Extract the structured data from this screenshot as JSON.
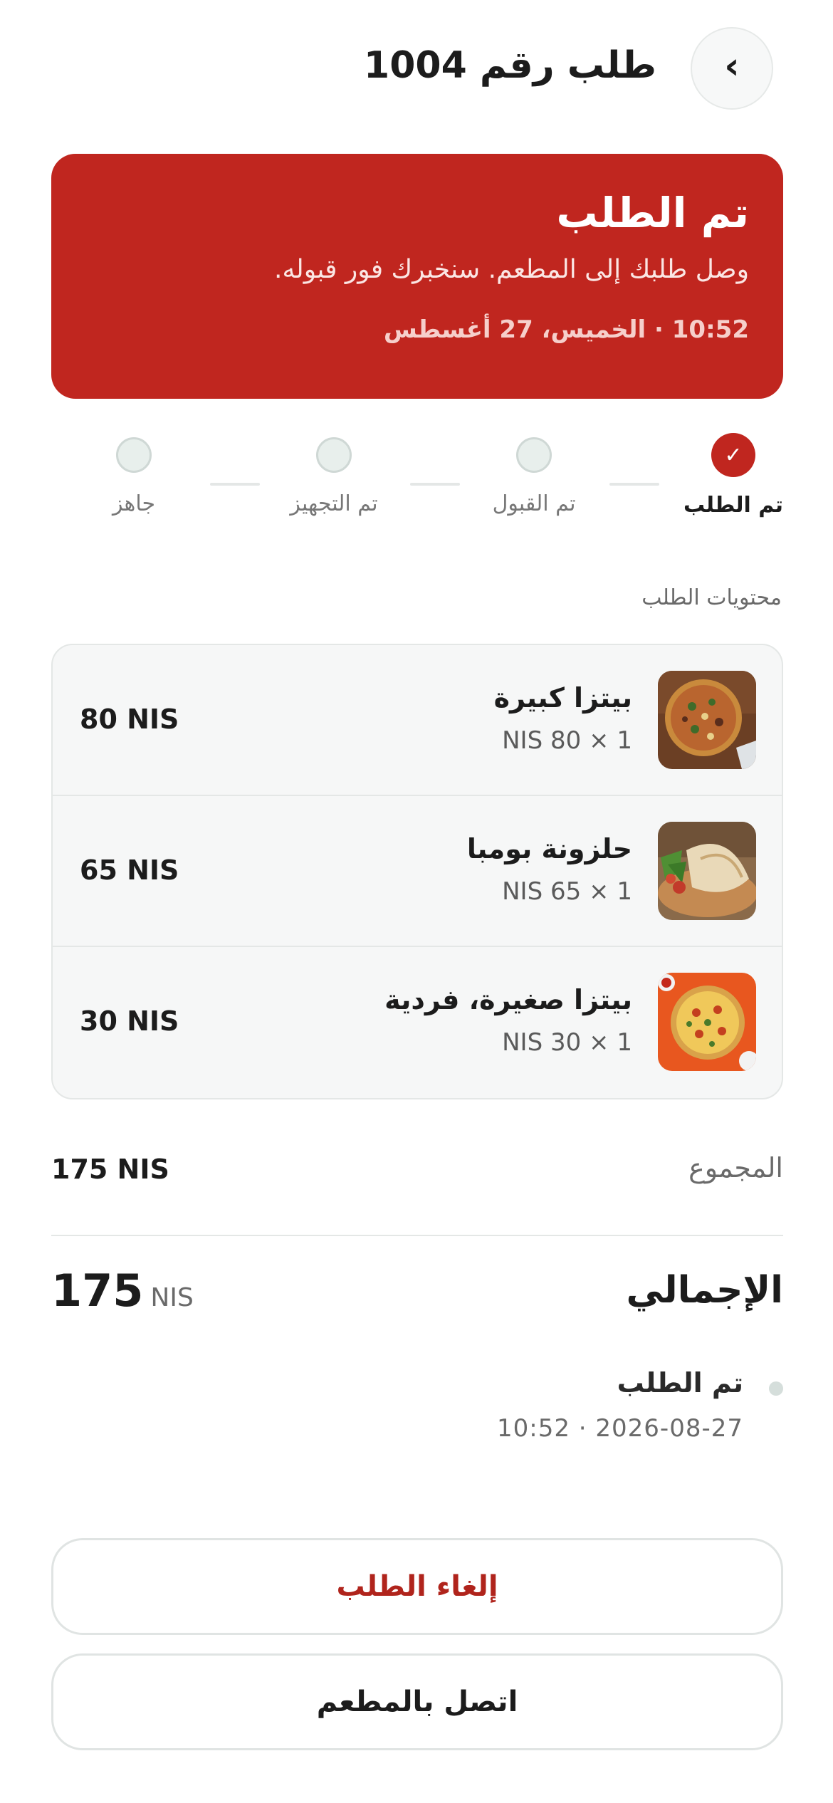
{
  "header": {
    "title": "طلب رقم 1004",
    "back_glyph": "‹"
  },
  "banner": {
    "title": "تم الطلب",
    "message": "وصل طلبك إلى المطعم. سنخبرك فور قبوله.",
    "time": "10:52 · الخميس، 27 أغسطس",
    "color": "#c0261f"
  },
  "stepper": {
    "steps": [
      {
        "label": "تم الطلب",
        "done": true
      },
      {
        "label": "تم القبول",
        "done": false
      },
      {
        "label": "تم التجهيز",
        "done": false
      },
      {
        "label": "جاهز",
        "done": false
      }
    ],
    "check_glyph": "✓"
  },
  "items_section": {
    "label": "محتويات الطلب",
    "items": [
      {
        "name": "بيتزا كبيرة",
        "qty": "1 × 80 NIS",
        "price": "80 NIS",
        "thumb": "pizza-large-image"
      },
      {
        "name": "حلزونة بومبا",
        "qty": "1 × 65 NIS",
        "price": "65 NIS",
        "thumb": "calzone-image"
      },
      {
        "name": "بيتزا صغيرة، فردية",
        "qty": "1 × 30 NIS",
        "price": "30 NIS",
        "thumb": "pizza-small-image"
      }
    ]
  },
  "totals": {
    "subtotal_label": "المجموع",
    "subtotal_value": "175 NIS",
    "total_label": "الإجمالي",
    "total_number": "175",
    "total_currency": "NIS"
  },
  "timeline": {
    "title": "تم الطلب",
    "time": "10:52 · 2026-08-27"
  },
  "actions": {
    "cancel_label": "إلغاء الطلب",
    "call_label": "اتصل بالمطعم"
  }
}
